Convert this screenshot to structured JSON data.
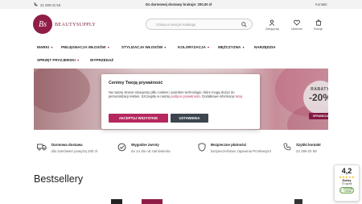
{
  "topbar": {
    "phone": "22 299 02 58",
    "promo": "Do darmowej dostawy brakuje: 200,00 zł",
    "contact": "Kontakt"
  },
  "logo": {
    "monogram": "Bs",
    "name": "BEAUTYSUPPLY"
  },
  "search": {
    "placeholder": "Szukaj w naszym katalogu"
  },
  "header_icons": [
    {
      "label": "Zaloguj się",
      "icon": "user-icon"
    },
    {
      "label": "Ulubione",
      "icon": "heart-icon"
    },
    {
      "label": "Koszyk",
      "icon": "cart-icon"
    }
  ],
  "menu": {
    "items": [
      {
        "label": "MARKI",
        "dropdown": true
      },
      {
        "label": "PIELĘGNACJA WŁOSÓW",
        "dropdown": true
      },
      {
        "label": "STYLIZACJA WŁOSÓW",
        "dropdown": true
      },
      {
        "label": "KOLORYZACJA",
        "dropdown": true
      },
      {
        "label": "MĘŻCZYZNA",
        "dropdown": true
      },
      {
        "label": "NARZĘDZIA",
        "dropdown": false
      },
      {
        "label": "SPRZĘT FRYZJERSKI",
        "dropdown": true
      },
      {
        "label": "WYPRZEDAŻ",
        "dropdown": false
      }
    ]
  },
  "hero": {
    "badge_line1": "RABATY",
    "badge_line2": "-20%",
    "cta": "SPRAWDZAM"
  },
  "cookie": {
    "title": "Cenimy Twoją prywatność",
    "text_part1": "Na naszej stronie stosujemy pliki cookies i podobne technologie, które mogą służyć do personalizacji reklam. Szczegóły w naszej ",
    "policy_link": "polityce prywatności",
    "text_part2": ". Dodatkowe informacje ",
    "here_link": "tutaj",
    "accept_label": "AKCEPTUJ WSZYSTKIE",
    "settings_label": "USTAWIENIA"
  },
  "features": [
    {
      "title": "Darmowa dostawa",
      "subtitle": "dla zamówień powyżej 200 zł",
      "icon": "truck-icon"
    },
    {
      "title": "Wygodne zwroty",
      "subtitle": "do 14 dni od zamówienia",
      "icon": "return-icon"
    },
    {
      "title": "Bezpieczne płatności",
      "subtitle": "bezpieczeństwo zapewnia Przelewy24",
      "icon": "shield-icon"
    },
    {
      "title": "Szybki kontakt",
      "subtitle": "22 299 02 58",
      "icon": "phone-icon"
    }
  ],
  "section_title": "Bestsellery",
  "rating": {
    "score": "4,2",
    "stars": "★★★★★",
    "label": "Dobry",
    "count": "70 opinii",
    "badge": "ZAUFANE OPINIE"
  },
  "colors": {
    "brand": "#8f1d48",
    "accept": "#b5285f",
    "settings": "#3d4550"
  }
}
